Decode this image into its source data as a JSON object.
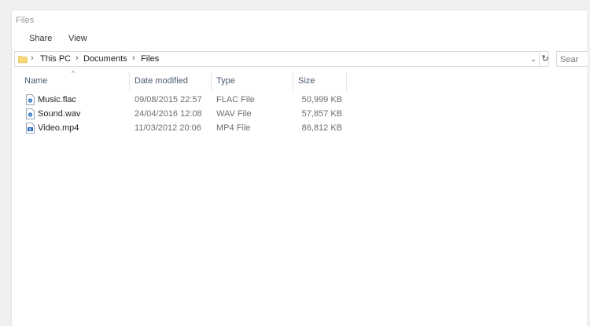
{
  "window": {
    "title": "Files"
  },
  "ribbon": {
    "tabs": [
      {
        "label": "Share"
      },
      {
        "label": "View"
      }
    ]
  },
  "address_bar": {
    "icon": "folder-icon",
    "separator": "›",
    "crumbs": [
      "This PC",
      "Documents",
      "Files"
    ],
    "dropdown_glyph": "⌄",
    "refresh_glyph": "↻"
  },
  "search": {
    "placeholder": "Sear"
  },
  "columns": {
    "name": "Name",
    "date_modified": "Date modified",
    "type": "Type",
    "size": "Size",
    "sort_glyph": "^"
  },
  "files": [
    {
      "name": "Music.flac",
      "date_modified": "09/08/2015 22:57",
      "type": "FLAC File",
      "size": "50,999 KB",
      "icon": "audio-file-icon"
    },
    {
      "name": "Sound.wav",
      "date_modified": "24/04/2016 12:08",
      "type": "WAV File",
      "size": "57,857 KB",
      "icon": "audio-file-icon"
    },
    {
      "name": "Video.mp4",
      "date_modified": "11/03/2012 20:06",
      "type": "MP4 File",
      "size": "86,812 KB",
      "icon": "video-file-icon"
    }
  ],
  "colors": {
    "header_text": "#4a5a6e",
    "folder_yellow": "#f8d775",
    "file_icon_blue": "#2f6fc0"
  }
}
